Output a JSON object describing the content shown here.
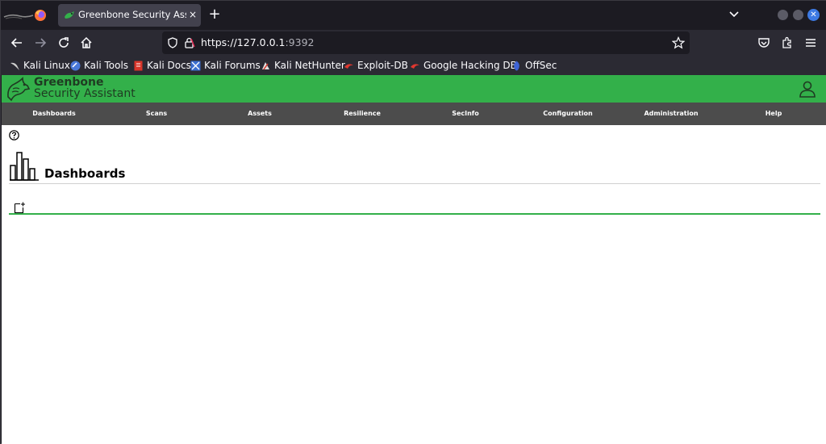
{
  "browser": {
    "tab_title": "Greenbone Security Assistant",
    "tab_close": "×",
    "new_tab": "+",
    "url_host": "https://127.0.0.1",
    "url_port": ":9392"
  },
  "bookmarks": [
    {
      "label": "Kali Linux",
      "icon": "kali-dragon-icon"
    },
    {
      "label": "Kali Tools",
      "icon": "kali-tools-icon"
    },
    {
      "label": "Kali Docs",
      "icon": "kali-docs-icon"
    },
    {
      "label": "Kali Forums",
      "icon": "kali-forums-icon"
    },
    {
      "label": "Kali NetHunter",
      "icon": "nethunter-icon"
    },
    {
      "label": "Exploit-DB",
      "icon": "exploit-db-icon"
    },
    {
      "label": "Google Hacking DB",
      "icon": "ghdb-icon"
    },
    {
      "label": "OffSec",
      "icon": "offsec-icon"
    }
  ],
  "gsa": {
    "brand_line1": "Greenbone",
    "brand_line2": "Security Assistant",
    "menu": [
      "Dashboards",
      "Scans",
      "Assets",
      "Resilience",
      "SecInfo",
      "Configuration",
      "Administration",
      "Help"
    ],
    "page_title": "Dashboards"
  },
  "colors": {
    "brand_green": "#33b04a",
    "menu_bg": "#4c4c4c",
    "browser_bg": "#1c1b22",
    "toolbar_bg": "#2b2a33"
  }
}
